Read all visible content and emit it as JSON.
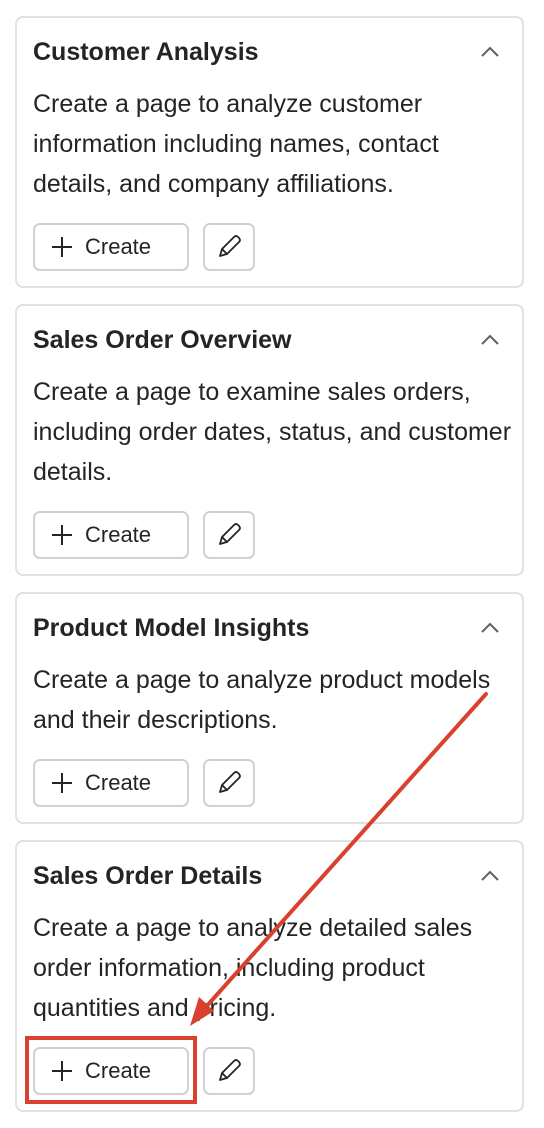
{
  "cards": [
    {
      "title": "Customer Analysis",
      "description": "Create a page to analyze customer information including names, contact details, and company affiliations.",
      "create_label": "Create",
      "collapse_icon": "chevron-up-icon",
      "edit_icon": "pencil-icon"
    },
    {
      "title": "Sales Order Overview",
      "description": "Create a page to examine sales orders, including order dates, status, and customer details.",
      "create_label": "Create",
      "collapse_icon": "chevron-up-icon",
      "edit_icon": "pencil-icon"
    },
    {
      "title": "Product Model Insights",
      "description": "Create a page to analyze product models and their descriptions.",
      "create_label": "Create",
      "collapse_icon": "chevron-up-icon",
      "edit_icon": "pencil-icon"
    },
    {
      "title": "Sales Order Details",
      "description": "Create a page to analyze detailed sales order information, including product quantities and pricing.",
      "create_label": "Create",
      "collapse_icon": "chevron-up-icon",
      "edit_icon": "pencil-icon"
    }
  ],
  "annotation": {
    "color": "#d9412f",
    "icon": "arrow-icon"
  }
}
